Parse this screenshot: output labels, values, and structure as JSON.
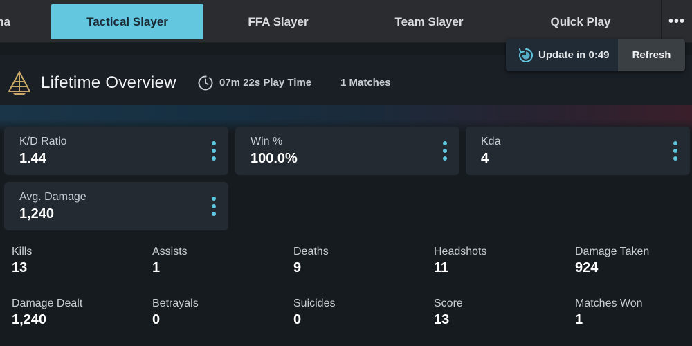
{
  "nav": {
    "tabs": [
      {
        "label": "na"
      },
      {
        "label": "Tactical Slayer"
      },
      {
        "label": "FFA Slayer"
      },
      {
        "label": "Team Slayer"
      },
      {
        "label": "Quick Play"
      }
    ],
    "more_label": "•••",
    "active_color": "#63c7df"
  },
  "update": {
    "text": "Update in 0:49",
    "refresh_label": "Refresh"
  },
  "overview": {
    "title": "Lifetime Overview",
    "play_time": "07m 22s Play Time",
    "matches": "1 Matches"
  },
  "cards": [
    {
      "label": "K/D Ratio",
      "value": "1.44"
    },
    {
      "label": "Win %",
      "value": "100.0%"
    },
    {
      "label": "Kda",
      "value": "4"
    },
    {
      "label": "Avg. Damage",
      "value": "1,240"
    }
  ],
  "stats": [
    {
      "label": "Kills",
      "value": "13"
    },
    {
      "label": "Assists",
      "value": "1"
    },
    {
      "label": "Deaths",
      "value": "9"
    },
    {
      "label": "Headshots",
      "value": "11"
    },
    {
      "label": "Damage Taken",
      "value": "924"
    },
    {
      "label": "Damage Dealt",
      "value": "1,240"
    },
    {
      "label": "Betrayals",
      "value": "0"
    },
    {
      "label": "Suicides",
      "value": "0"
    },
    {
      "label": "Score",
      "value": "13"
    },
    {
      "label": "Matches Won",
      "value": "1"
    }
  ],
  "colors": {
    "accent": "#5fc6de",
    "background": "#161b20",
    "card": "#232a31",
    "logo_gold": "#c9a86a"
  },
  "icons": {
    "logo": "pyramid-logo-icon",
    "clock": "clock-icon",
    "update": "timer-refresh-icon",
    "more": "more-dots-icon",
    "card_menu": "vertical-dots-icon"
  }
}
